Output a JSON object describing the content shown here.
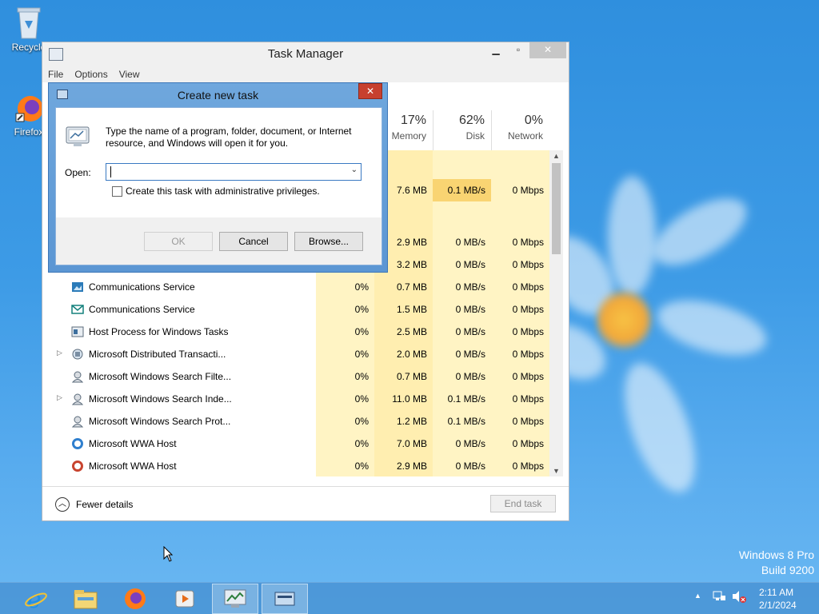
{
  "desktop": {
    "recycle_label": "Recycle",
    "firefox_label": "Firefox",
    "watermark_line1": "Windows 8 Pro",
    "watermark_line2": "Build 9200"
  },
  "task_manager": {
    "title": "Task Manager",
    "menu": [
      "File",
      "Options",
      "View"
    ],
    "headers": {
      "memory": {
        "percent": "17%",
        "label": "Memory"
      },
      "disk": {
        "percent": "62%",
        "label": "Disk"
      },
      "network": {
        "percent": "0%",
        "label": "Network"
      }
    },
    "top_rows": [
      {
        "memory": "7.6 MB",
        "disk": "0.1 MB/s",
        "network": "0 Mbps"
      },
      {
        "memory": "2.9 MB",
        "disk": "0 MB/s",
        "network": "0 Mbps"
      },
      {
        "memory": "3.2 MB",
        "disk": "0 MB/s",
        "network": "0 Mbps"
      }
    ],
    "rows": [
      {
        "name": "Communications Service",
        "cpu": "0%",
        "memory": "0.7 MB",
        "disk": "0 MB/s",
        "network": "0 Mbps",
        "expand": false
      },
      {
        "name": "Communications Service",
        "cpu": "0%",
        "memory": "1.5 MB",
        "disk": "0 MB/s",
        "network": "0 Mbps",
        "expand": false
      },
      {
        "name": "Host Process for Windows Tasks",
        "cpu": "0%",
        "memory": "2.5 MB",
        "disk": "0 MB/s",
        "network": "0 Mbps",
        "expand": false
      },
      {
        "name": "Microsoft Distributed Transacti...",
        "cpu": "0%",
        "memory": "2.0 MB",
        "disk": "0 MB/s",
        "network": "0 Mbps",
        "expand": true
      },
      {
        "name": "Microsoft Windows Search Filte...",
        "cpu": "0%",
        "memory": "0.7 MB",
        "disk": "0 MB/s",
        "network": "0 Mbps",
        "expand": false
      },
      {
        "name": "Microsoft Windows Search Inde...",
        "cpu": "0%",
        "memory": "11.0 MB",
        "disk": "0.1 MB/s",
        "network": "0 Mbps",
        "expand": true
      },
      {
        "name": "Microsoft Windows Search Prot...",
        "cpu": "0%",
        "memory": "1.2 MB",
        "disk": "0.1 MB/s",
        "network": "0 Mbps",
        "expand": false
      },
      {
        "name": "Microsoft WWA Host",
        "cpu": "0%",
        "memory": "7.0 MB",
        "disk": "0 MB/s",
        "network": "0 Mbps",
        "expand": false
      },
      {
        "name": "Microsoft WWA Host",
        "cpu": "0%",
        "memory": "2.9 MB",
        "disk": "0 MB/s",
        "network": "0 Mbps",
        "expand": false
      }
    ],
    "fewer_details": "Fewer details",
    "end_task": "End task"
  },
  "dialog": {
    "title": "Create new task",
    "message": "Type the name of a program, folder, document, or Internet resource, and Windows will open it for you.",
    "open_label": "Open:",
    "open_value": "",
    "admin_checkbox": "Create this task with administrative privileges.",
    "ok": "OK",
    "cancel": "Cancel",
    "browse": "Browse..."
  },
  "taskbar": {
    "time": "2:11 AM",
    "date": "2/1/2024"
  },
  "colors": {
    "heat_light": "#fff4c4",
    "heat_mid": "#ffe89a",
    "heat_strong": "#f9d472"
  }
}
